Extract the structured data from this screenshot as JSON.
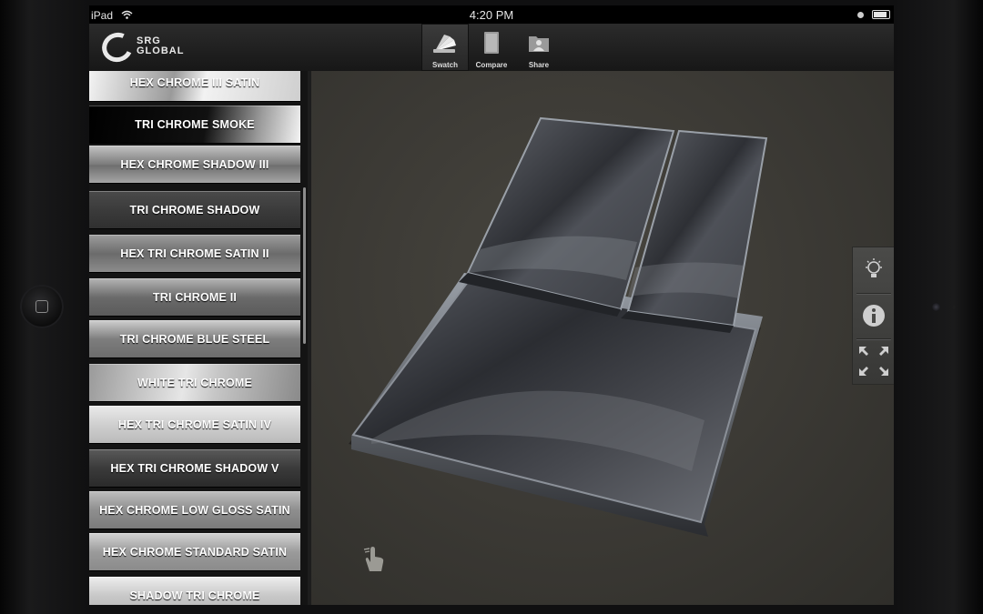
{
  "device": {
    "carrier": "iPad",
    "time": "4:20 PM"
  },
  "brand": {
    "line1": "SRG",
    "line2": "GLOBAL"
  },
  "toolbar": [
    {
      "label": "Swatch",
      "icon": "swatch-fan-icon",
      "active": true
    },
    {
      "label": "Compare",
      "icon": "compare-panel-icon",
      "active": false
    },
    {
      "label": "Share",
      "icon": "share-person-icon",
      "active": false
    }
  ],
  "finishes": [
    "HEX CHROME III SATIN",
    "TRI CHROME SMOKE",
    "HEX CHROME SHADOW III",
    "TRI CHROME SHADOW",
    "HEX TRI CHROME SATIN II",
    "TRI CHROME II",
    "TRI CHROME BLUE STEEL",
    "WHITE TRI CHROME",
    "HEX TRI CHROME  SATIN IV",
    "HEX TRI CHROME SHADOW V",
    "HEX CHROME LOW GLOSS SATIN",
    "HEX CHROME STANDARD SATIN",
    "SHADOW TRI CHROME"
  ],
  "side_tools": [
    "lightbulb-icon",
    "info-icon",
    "expand-arrows-icon"
  ],
  "colors": {
    "accent": "#7aa9c8",
    "swatch": "#3c3f45"
  }
}
